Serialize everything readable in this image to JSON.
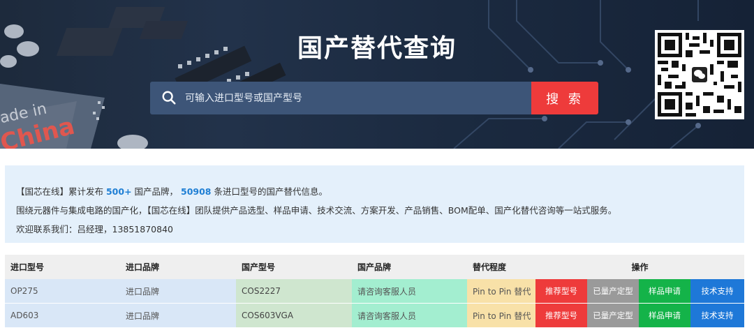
{
  "banner": {
    "title": "国产替代查询",
    "search_placeholder": "可输入进口型号或国产型号",
    "search_button": "搜 索",
    "chip_text_1": "ade in",
    "chip_text_2": "China"
  },
  "info": {
    "line1_prefix": "【国芯在线】累计发布 ",
    "brand_count": "500+",
    "line1_mid": " 国产品牌， ",
    "model_count": "50908",
    "line1_suffix": " 条进口型号的国产替代信息。",
    "line2": "围绕元器件与集成电路的国产化，【国芯在线】团队提供产品选型、样品申请、技术交流、方案开发、产品销售、BOM配单、国产化替代咨询等一站式服务。",
    "line3": "欢迎联系我们：吕经理，13851870840"
  },
  "table": {
    "headers": [
      "进口型号",
      "进口品牌",
      "国产型号",
      "国产品牌",
      "替代程度",
      "操作"
    ],
    "rows": [
      {
        "import_model": "OP275",
        "import_brand": "进口品牌",
        "domestic_model": "COS2227",
        "domestic_brand": "请咨询客服人员",
        "degree": "Pin to Pin 替代",
        "actions": [
          "推荐型号",
          "已量产定型",
          "样品申请",
          "技术支持"
        ]
      },
      {
        "import_model": "AD603",
        "import_brand": "进口品牌",
        "domestic_model": "COS603VGA",
        "domestic_brand": "请咨询客服人员",
        "degree": "Pin to Pin 替代",
        "actions": [
          "推荐型号",
          "已量产定型",
          "样品申请",
          "技术支持"
        ]
      }
    ]
  },
  "colors": {
    "search_button": "#ee3b3b",
    "highlight": "#1f7fd4",
    "action_recommend": "#ee3b3b",
    "action_mass": "#9a9a9a",
    "action_sample": "#14b349",
    "action_support": "#1e78d8"
  }
}
